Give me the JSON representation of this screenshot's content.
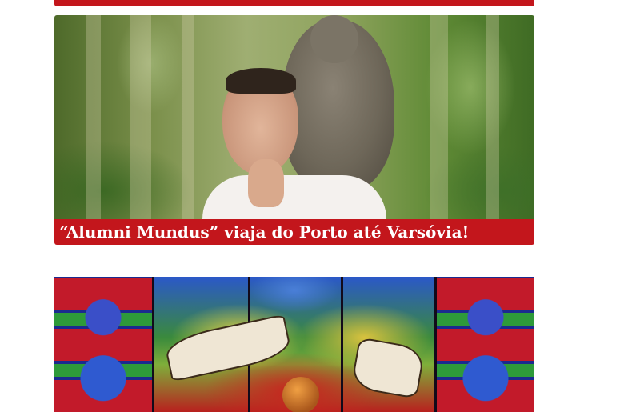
{
  "articles": [
    {
      "caption": "“Alumni Mundus” viaja do Porto até Varsóvia!",
      "image_alt": "man with a monkey on his shoulder in a forest"
    },
    {
      "caption": "",
      "image_alt": "stained glass window with banners and palm leaves"
    }
  ],
  "colors": {
    "accent": "#c3161c"
  }
}
